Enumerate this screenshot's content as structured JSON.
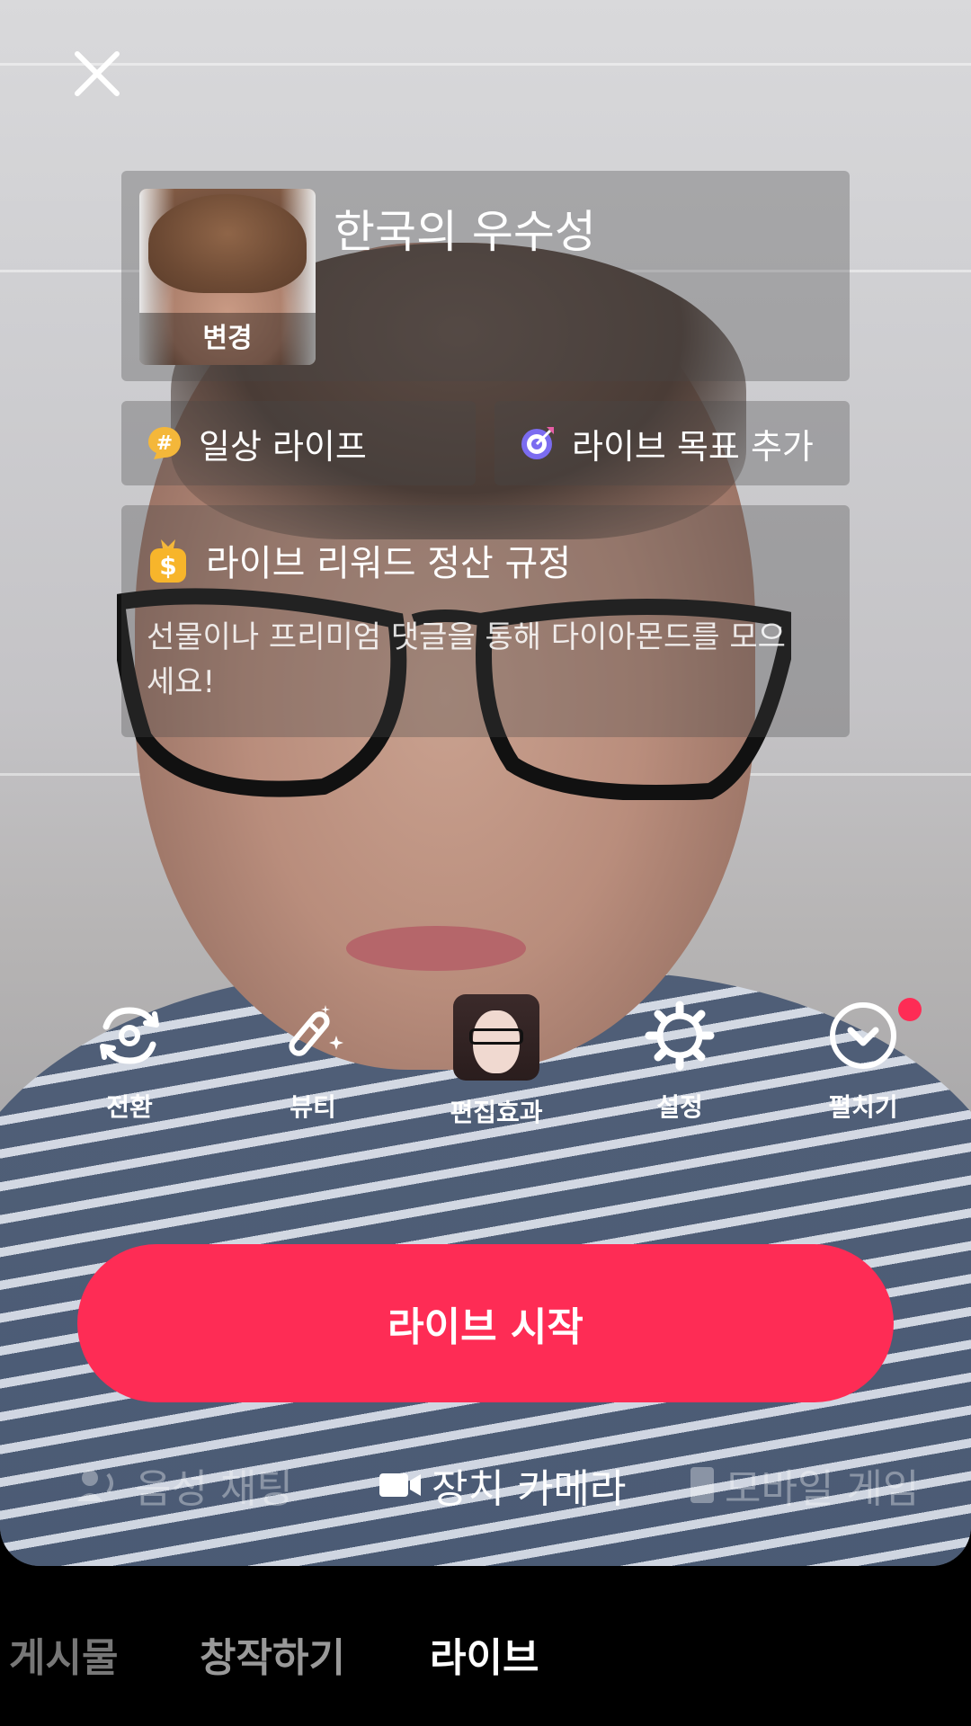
{
  "top": {
    "close_icon": "close-icon"
  },
  "title_card": {
    "avatar_change_label": "변경",
    "title": "한국의 우수성"
  },
  "topic_pill": {
    "icon": "hash-icon",
    "label": "일상 라이프"
  },
  "goal_pill": {
    "icon": "target-icon",
    "label": "라이브 목표 추가"
  },
  "reward_card": {
    "icon": "money-bag-icon",
    "title": "라이브 리워드 정산 규정",
    "description": "선물이나 프리미엄 댓글을 통해 다이아몬드를 모으세요!"
  },
  "tools": [
    {
      "icon": "flip-camera-icon",
      "label": "전환"
    },
    {
      "icon": "beauty-wand-icon",
      "label": "뷰티"
    },
    {
      "icon": "effect-thumbnail",
      "label": "편집효과"
    },
    {
      "icon": "gear-icon",
      "label": "설정"
    },
    {
      "icon": "chevron-down-circle-icon",
      "label": "펼치기"
    }
  ],
  "start_button": {
    "label": "라이브 시작"
  },
  "modes": [
    {
      "icon": "voice-chat-icon",
      "label": "음성 채팅"
    },
    {
      "icon": "video-camera-icon",
      "label": "장치 카메라"
    },
    {
      "icon": "mobile-game-icon",
      "label": "모바일 게임"
    }
  ],
  "bottom_tabs": [
    {
      "label": "게시물"
    },
    {
      "label": "창작하기"
    },
    {
      "label": "라이브"
    }
  ],
  "colors": {
    "accent": "#fe2c55",
    "notification_dot": "#fe2c55"
  }
}
